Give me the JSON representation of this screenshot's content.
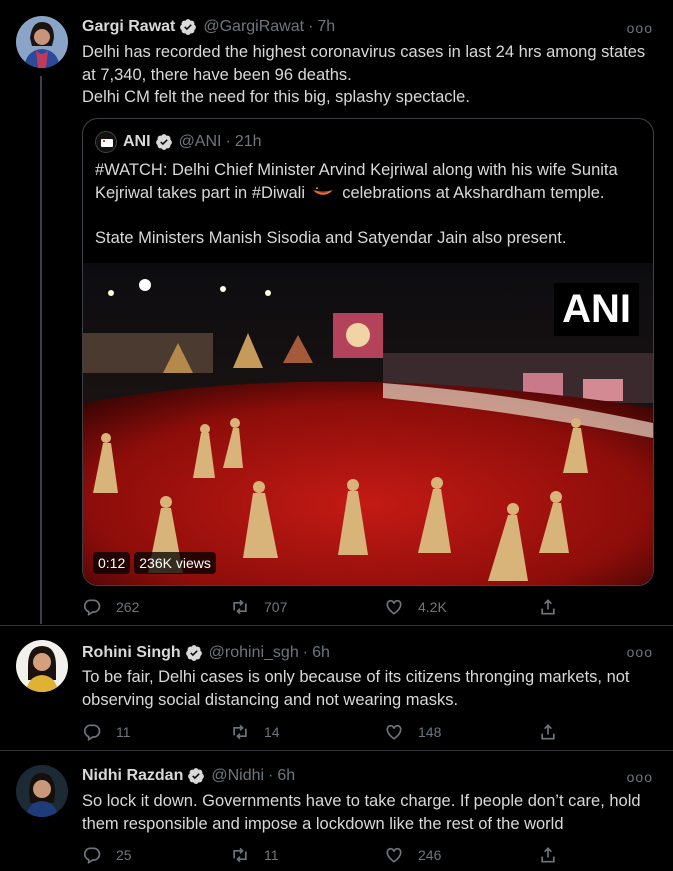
{
  "tweets": [
    {
      "name": "Gargi Rawat",
      "handle": "@GargiRawat",
      "dot": "·",
      "time": "7h",
      "more": "ooo",
      "lines": [
        "Delhi has recorded the highest coronavirus cases in last 24 hrs among states",
        "at 7,340, there have been 96 deaths.",
        "Delhi CM felt the need for this big, splashy spectacle."
      ],
      "replies": "262",
      "retweets": "707",
      "likes": "4.2K"
    },
    {
      "name": "Rohini Singh",
      "handle": "@rohini_sgh",
      "dot": "·",
      "time": "6h",
      "more": "ooo",
      "lines": [
        "To be fair, Delhi cases is only because of its citizens thronging markets, not",
        "observing social distancing and not wearing masks."
      ],
      "replies": "11",
      "retweets": "14",
      "likes": "148"
    },
    {
      "name": "Nidhi Razdan",
      "handle": "@Nidhi",
      "dot": "·",
      "time": "6h",
      "more": "ooo",
      "lines": [
        "So lock it down. Governments have to take charge. If people don’t care, hold",
        "them responsible and impose a lockdown like the rest of the world"
      ],
      "replies": "25",
      "retweets": "11",
      "likes": "246"
    }
  ],
  "quote": {
    "name": "ANI",
    "handle": "@ANI",
    "dot": "·",
    "time": "21h",
    "line1": "#WATCH: Delhi Chief Minister Arvind Kejriwal along with his wife Sunita",
    "line2a": "Kejriwal takes part in #Diwali",
    "line2b": "celebrations at Akshardham temple.",
    "line3": "State Ministers Manish Sisodia and Satyendar Jain also present.",
    "video_watermark": "ANI",
    "video_duration": "0:12",
    "video_views": "236K views"
  },
  "colors": {
    "background": "#000000",
    "text": "#d9d9d9",
    "muted": "#6e767d",
    "verified": "#d9d9d9",
    "border": "#2f3336"
  },
  "icons": [
    "verified-badge-icon",
    "more-icon",
    "reply-icon",
    "retweet-icon",
    "like-icon",
    "share-icon",
    "diya-emoji-icon"
  ]
}
